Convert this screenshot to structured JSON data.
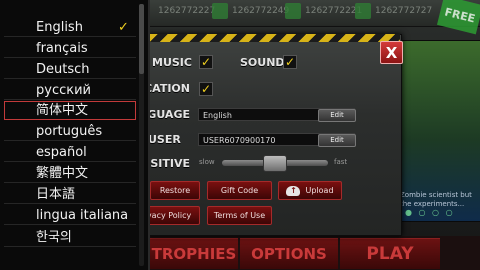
{
  "topbar": {
    "stats": [
      "1262772227",
      "1262772249",
      "1262772221",
      "1262772727"
    ],
    "free_badge": "FREE"
  },
  "right_panel": {
    "caption": "Zombie scientist but the experiments..."
  },
  "settings": {
    "music_label": "MUSIC",
    "music_checked": true,
    "sound_label": "SOUND",
    "sound_checked": true,
    "notification_label": "NOTIFICATION",
    "notification_checked": true,
    "language_label": "LANGUAGE",
    "language_value": "English",
    "language_edit": "Edit",
    "username_label": "USER NAME",
    "username_value": "USER6070900170",
    "username_edit": "Edit",
    "sensitive_label": "SENSITIVE",
    "slider_min_label": "slow",
    "slider_max_label": "fast",
    "slider_value": 0.4,
    "restore_label": "Restore",
    "gift_code_label": "Gift Code",
    "upload_label": "Upload",
    "privacy_label": "Privacy Policy",
    "terms_label": "Terms of Use",
    "close_label": "X"
  },
  "bottom_nav": {
    "trophies": "TROPHIES",
    "options": "OPTIONS",
    "play": "PLAY"
  },
  "languages": {
    "selected": "English",
    "check_mark": "✓",
    "items": [
      "English",
      "français",
      "Deutsch",
      "русский",
      "简体中文",
      "português",
      "español",
      "繁體中文",
      "日本語",
      "lingua italiana",
      "한국의"
    ]
  },
  "colors": {
    "accent_yellow": "#f0d020",
    "button_red": "#7a1010",
    "highlight_outline": "#c23a3a"
  }
}
